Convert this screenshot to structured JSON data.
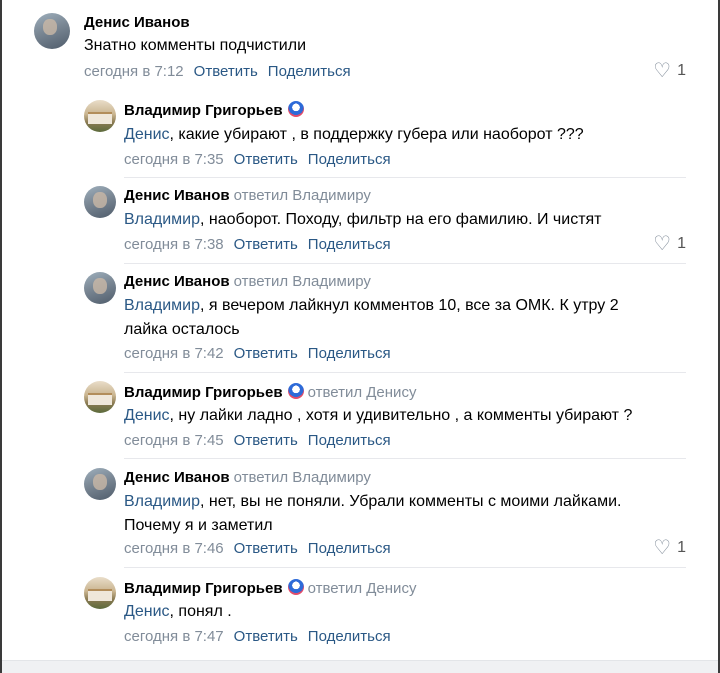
{
  "comments": [
    {
      "author": "Денис Иванов",
      "replied_to": "",
      "badge": false,
      "mention": "",
      "text": "Знатно комменты подчистили",
      "time": "сегодня в 7:12",
      "reply_label": "Ответить",
      "share_label": "Поделиться",
      "likes": "1"
    },
    {
      "author": "Владимир Григорьев",
      "replied_to": "",
      "badge": true,
      "mention": "Денис",
      "text": ", какие убирают , в поддержку губера или наоборот ???",
      "time": "сегодня в 7:35",
      "reply_label": "Ответить",
      "share_label": "Поделиться",
      "likes": ""
    },
    {
      "author": "Денис Иванов",
      "replied_to": "ответил Владимиру",
      "badge": false,
      "mention": "Владимир",
      "text": ", наоборот. Походу, фильтр на его фамилию. И чистят",
      "time": "сегодня в 7:38",
      "reply_label": "Ответить",
      "share_label": "Поделиться",
      "likes": "1"
    },
    {
      "author": "Денис Иванов",
      "replied_to": "ответил Владимиру",
      "badge": false,
      "mention": "Владимир",
      "text": ", я вечером лайкнул комментов 10, все за ОМК. К утру 2 лайка осталось",
      "time": "сегодня в 7:42",
      "reply_label": "Ответить",
      "share_label": "Поделиться",
      "likes": ""
    },
    {
      "author": "Владимир Григорьев",
      "replied_to": "ответил Денису",
      "badge": true,
      "mention": "Денис",
      "text": ", ну лайки ладно , хотя и удивительно , а комменты убирают ?",
      "time": "сегодня в 7:45",
      "reply_label": "Ответить",
      "share_label": "Поделиться",
      "likes": ""
    },
    {
      "author": "Денис Иванов",
      "replied_to": "ответил Владимиру",
      "badge": false,
      "mention": "Владимир",
      "text": ", нет, вы не поняли. Убрали комменты с моими лайками. Почему я и заметил",
      "time": "сегодня в 7:46",
      "reply_label": "Ответить",
      "share_label": "Поделиться",
      "likes": "1"
    },
    {
      "author": "Владимир Григорьев",
      "replied_to": "ответил Денису",
      "badge": true,
      "mention": "Денис",
      "text": ", понял .",
      "time": "сегодня в 7:47",
      "reply_label": "Ответить",
      "share_label": "Поделиться",
      "likes": ""
    }
  ],
  "icons": {
    "like": "heart-icon",
    "badge": "donut-badge-icon"
  },
  "colors": {
    "link": "#2a5885",
    "secondary": "#818c99",
    "separator": "#e7e8ec"
  }
}
